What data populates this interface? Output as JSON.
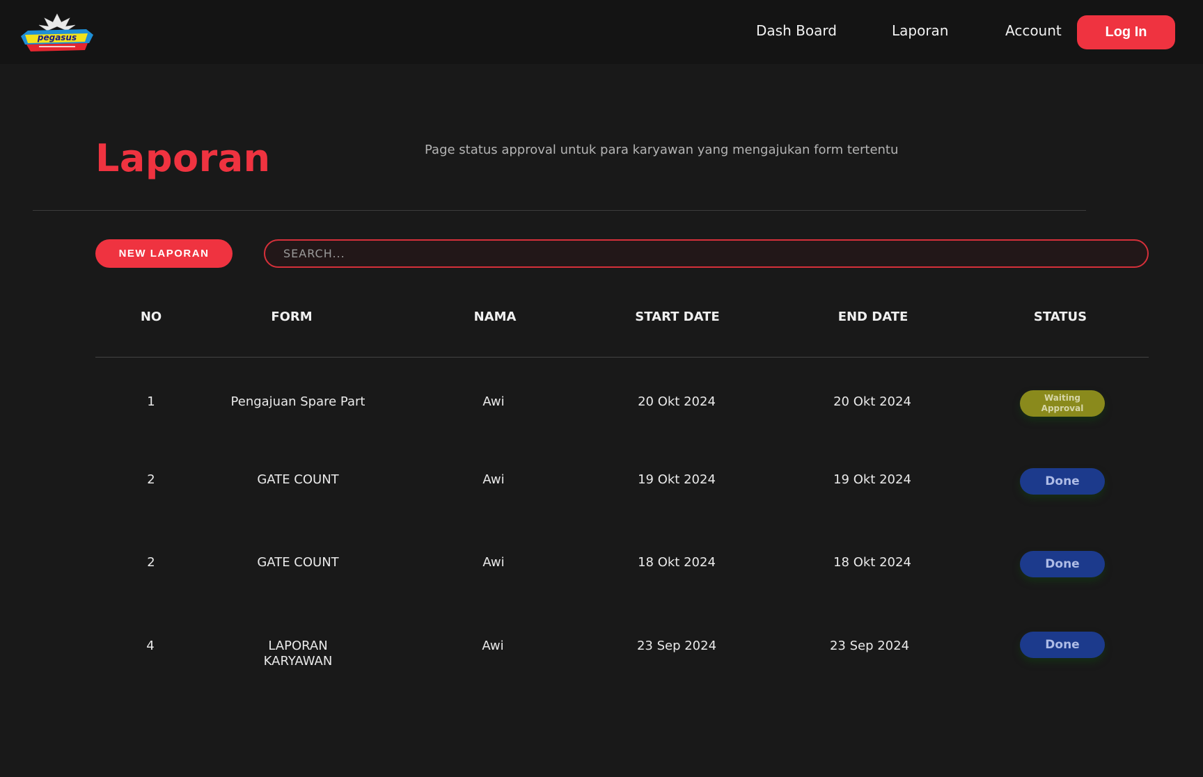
{
  "nav": {
    "logo_text": "pegasus",
    "links": [
      "Dash Board",
      "Laporan",
      "Account"
    ],
    "login_label": "Log In"
  },
  "header": {
    "title": "Laporan",
    "subtitle": "Page status approval untuk para karyawan yang mengajukan form tertentu"
  },
  "toolbar": {
    "new_label": "NEW LAPORAN",
    "search_placeholder": "SEARCH..."
  },
  "table": {
    "columns": [
      "NO",
      "FORM",
      "NAMA",
      "START DATE",
      "END DATE",
      "STATUS"
    ],
    "rows": [
      {
        "no": "1",
        "form": "Pengajuan Spare Part",
        "nama": "Awi",
        "start": "20 Okt 2024",
        "end": "20 Okt 2024",
        "status": "Waiting Approval"
      },
      {
        "no": "2",
        "form": "GATE COUNT",
        "nama": "Awi",
        "start": "19 Okt 2024",
        "end": "19 Okt 2024",
        "status": "Done"
      },
      {
        "no": "2",
        "form": "GATE COUNT",
        "nama": "Awi",
        "start": "18 Okt 2024",
        "end": "18 Okt 2024",
        "status": "Done"
      },
      {
        "no": "4",
        "form": "LAPORAN KARYAWAN",
        "nama": "Awi",
        "start": "23 Sep 2024",
        "end": "23 Sep 2024",
        "status": "Done"
      }
    ]
  },
  "colors": {
    "accent": "#ef3340",
    "waiting": "#8a8a1c",
    "done": "#1c3a8c"
  }
}
